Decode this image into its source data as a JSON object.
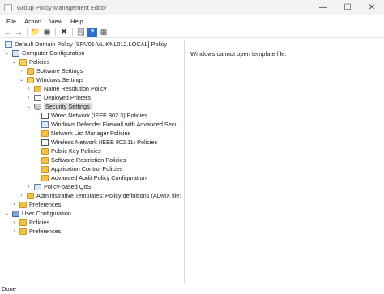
{
  "window": {
    "title": "Group Policy Management Editor",
    "minimize_glyph": "—",
    "maximize_glyph": "☐",
    "close_glyph": "✕"
  },
  "menu": [
    "File",
    "Action",
    "View",
    "Help"
  ],
  "toolbar": {
    "back_icon": "←",
    "forward_icon": "→",
    "up_icon": "📁",
    "show_hide_icon": "▣",
    "delete_icon": "✖",
    "properties_icon": "🗒",
    "help_icon": "?",
    "console_icon": "▦"
  },
  "tree": {
    "root": "Default Domain Policy [SRV01-VL.KNL012.LOCAL] Policy",
    "computer_configuration": "Computer Configuration",
    "policies": "Policies",
    "software_settings": "Software Settings",
    "windows_settings": "Windows Settings",
    "name_resolution_policy": "Name Resolution Policy",
    "deployed_printers": "Deployed Printers",
    "security_settings": "Security Settings",
    "wired_network": "Wired Network (IEEE 802.3) Policies",
    "defender_firewall": "Windows Defender Firewall with Advanced Secu",
    "network_list_manager": "Network List Manager Policies",
    "wireless_network": "Wireless Network (IEEE 802.11) Policies",
    "public_key": "Public Key Policies",
    "software_restriction": "Software Restriction Policies",
    "application_control": "Application Control Policies",
    "advanced_audit": "Advanced Audit Policy Configuration",
    "policy_qos": "Policy-based QoS",
    "admin_templates": "Administrative Templates: Policy definitions (ADMX file:",
    "cc_preferences": "Preferences",
    "user_configuration": "User Configuration",
    "uc_policies": "Policies",
    "uc_preferences": "Preferences"
  },
  "right_pane": {
    "message": "Windows cannot open template file."
  },
  "status": "Done"
}
